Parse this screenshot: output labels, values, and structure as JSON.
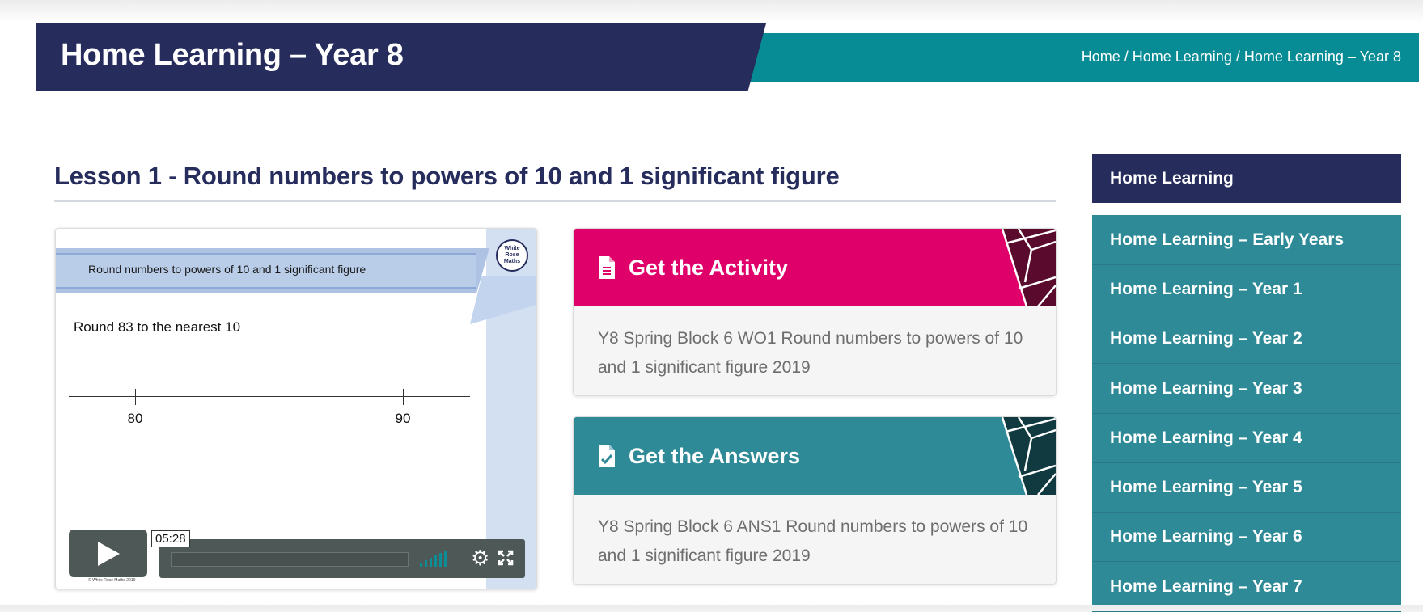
{
  "header": {
    "title": "Home Learning – Year 8",
    "breadcrumb": [
      "Home",
      "Home Learning",
      "Home Learning – Year 8"
    ],
    "breadcrumb_separator": "/",
    "colors": {
      "title_band": "#262d5d",
      "breadcrumb_band": "#078c96"
    }
  },
  "lesson": {
    "title": "Lesson 1 - Round numbers to powers of 10 and 1 significant figure"
  },
  "video": {
    "slide_heading": "Round numbers to powers of 10 and 1 significant figure",
    "logo_text": [
      "White",
      "Rose",
      "Maths"
    ],
    "question": "Round 83 to the nearest 10",
    "number_line": {
      "labels": [
        "80",
        "90"
      ]
    },
    "copyright": "© White Rose Maths 2019",
    "time": "05:28",
    "icons": {
      "play": "play-icon",
      "volume": "volume-icon",
      "settings": "gear-icon",
      "fullscreen": "fullscreen-icon"
    }
  },
  "cards": {
    "activity": {
      "title": "Get the Activity",
      "description": "Y8 Spring Block 6 WO1 Round numbers to powers of 10 and 1 significant figure 2019",
      "color": "#e0006a",
      "icon": "document-icon"
    },
    "answers": {
      "title": "Get the Answers",
      "description": "Y8 Spring Block 6 ANS1 Round numbers to powers of 10 and 1 significant figure 2019",
      "color": "#2e8a97",
      "icon": "checked-document-icon"
    }
  },
  "sidebar": {
    "header": "Home Learning",
    "items": [
      {
        "label": "Home Learning – Early Years"
      },
      {
        "label": "Home Learning – Year 1"
      },
      {
        "label": "Home Learning – Year 2"
      },
      {
        "label": "Home Learning – Year 3"
      },
      {
        "label": "Home Learning – Year 4"
      },
      {
        "label": "Home Learning – Year 5"
      },
      {
        "label": "Home Learning – Year 6"
      },
      {
        "label": "Home Learning – Year 7"
      }
    ],
    "colors": {
      "header": "#262d5d",
      "list": "#2e8a97"
    }
  }
}
